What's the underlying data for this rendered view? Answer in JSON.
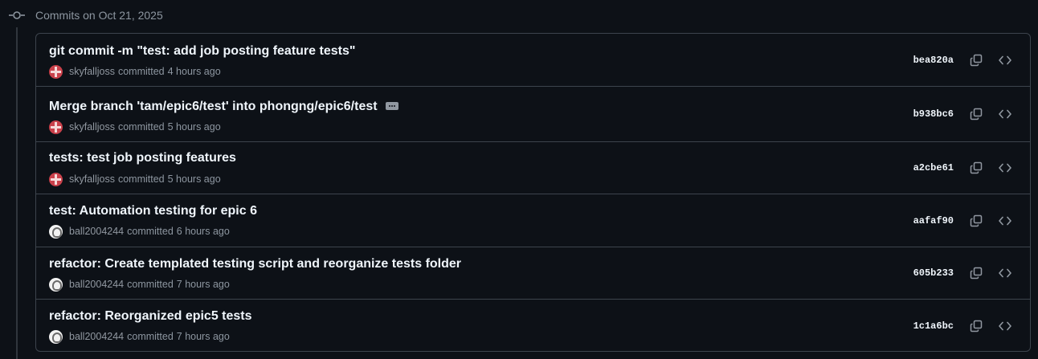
{
  "group": {
    "title": "Commits on Oct 21, 2025",
    "icon": "git-commit-icon"
  },
  "colors": {
    "background": "#0d1117",
    "border": "#3d444d",
    "muted_text": "#8d96a0",
    "title_text": "#f0f6fc"
  },
  "commits": [
    {
      "title": "git commit -m \"test: add job posting feature tests\"",
      "author": "skyfalljoss",
      "action": "committed",
      "time": "4 hours ago",
      "sha": "bea820a",
      "avatar": "red-cross-avatar",
      "has_ellipsis": false
    },
    {
      "title": "Merge branch 'tam/epic6/test' into phongng/epic6/test",
      "author": "skyfalljoss",
      "action": "committed",
      "time": "5 hours ago",
      "sha": "b938bc6",
      "avatar": "red-cross-avatar",
      "has_ellipsis": true
    },
    {
      "title": "tests: test job posting features",
      "author": "skyfalljoss",
      "action": "committed",
      "time": "5 hours ago",
      "sha": "a2cbe61",
      "avatar": "red-cross-avatar",
      "has_ellipsis": false
    },
    {
      "title": "test: Automation testing for epic 6",
      "author": "ball2004244",
      "action": "committed",
      "time": "6 hours ago",
      "sha": "aafaf90",
      "avatar": "white-sketch-avatar",
      "has_ellipsis": false
    },
    {
      "title": "refactor: Create templated testing script and reorganize tests folder",
      "author": "ball2004244",
      "action": "committed",
      "time": "7 hours ago",
      "sha": "605b233",
      "avatar": "white-sketch-avatar",
      "has_ellipsis": false
    },
    {
      "title": "refactor: Reorganized epic5 tests",
      "author": "ball2004244",
      "action": "committed",
      "time": "7 hours ago",
      "sha": "1c1a6bc",
      "avatar": "white-sketch-avatar",
      "has_ellipsis": false
    }
  ],
  "row_actions": {
    "copy_icon": "copy-icon",
    "browse_icon": "code-icon"
  }
}
